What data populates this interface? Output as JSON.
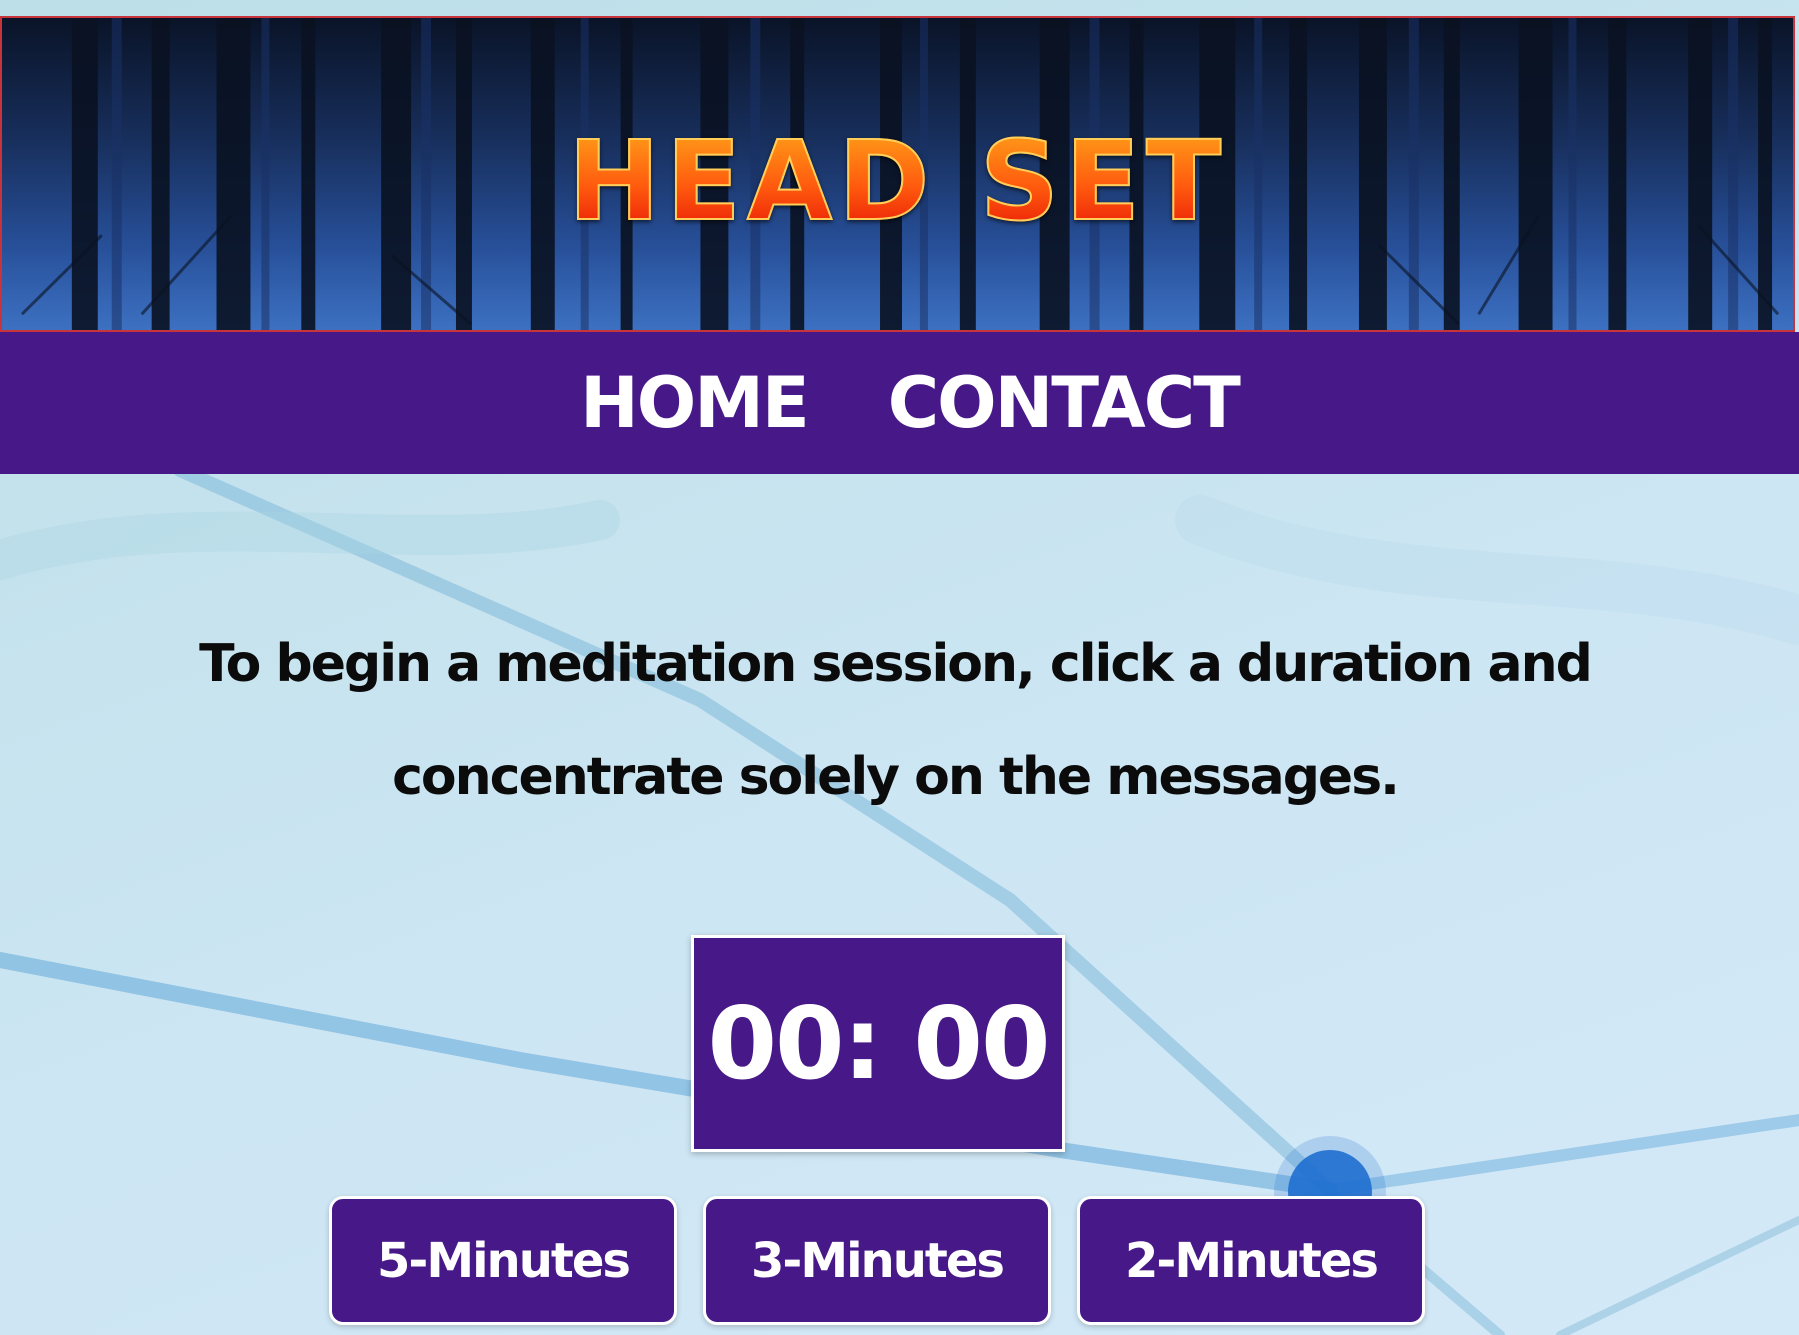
{
  "header": {
    "title": "HEAD SET"
  },
  "nav": {
    "items": [
      {
        "label": "HOME"
      },
      {
        "label": "CONTACT"
      }
    ]
  },
  "main": {
    "instructions": "To begin a meditation session, click a duration and concentrate solely on the messages.",
    "timer": "00: 00",
    "durations": [
      {
        "label": "5-Minutes"
      },
      {
        "label": "3-Minutes"
      },
      {
        "label": "2-Minutes"
      }
    ]
  },
  "colors": {
    "accent_purple": "#471888",
    "banner_border": "#c8343c",
    "title_orange": "#ff5a0e",
    "page_background": "#c6e3ee"
  }
}
